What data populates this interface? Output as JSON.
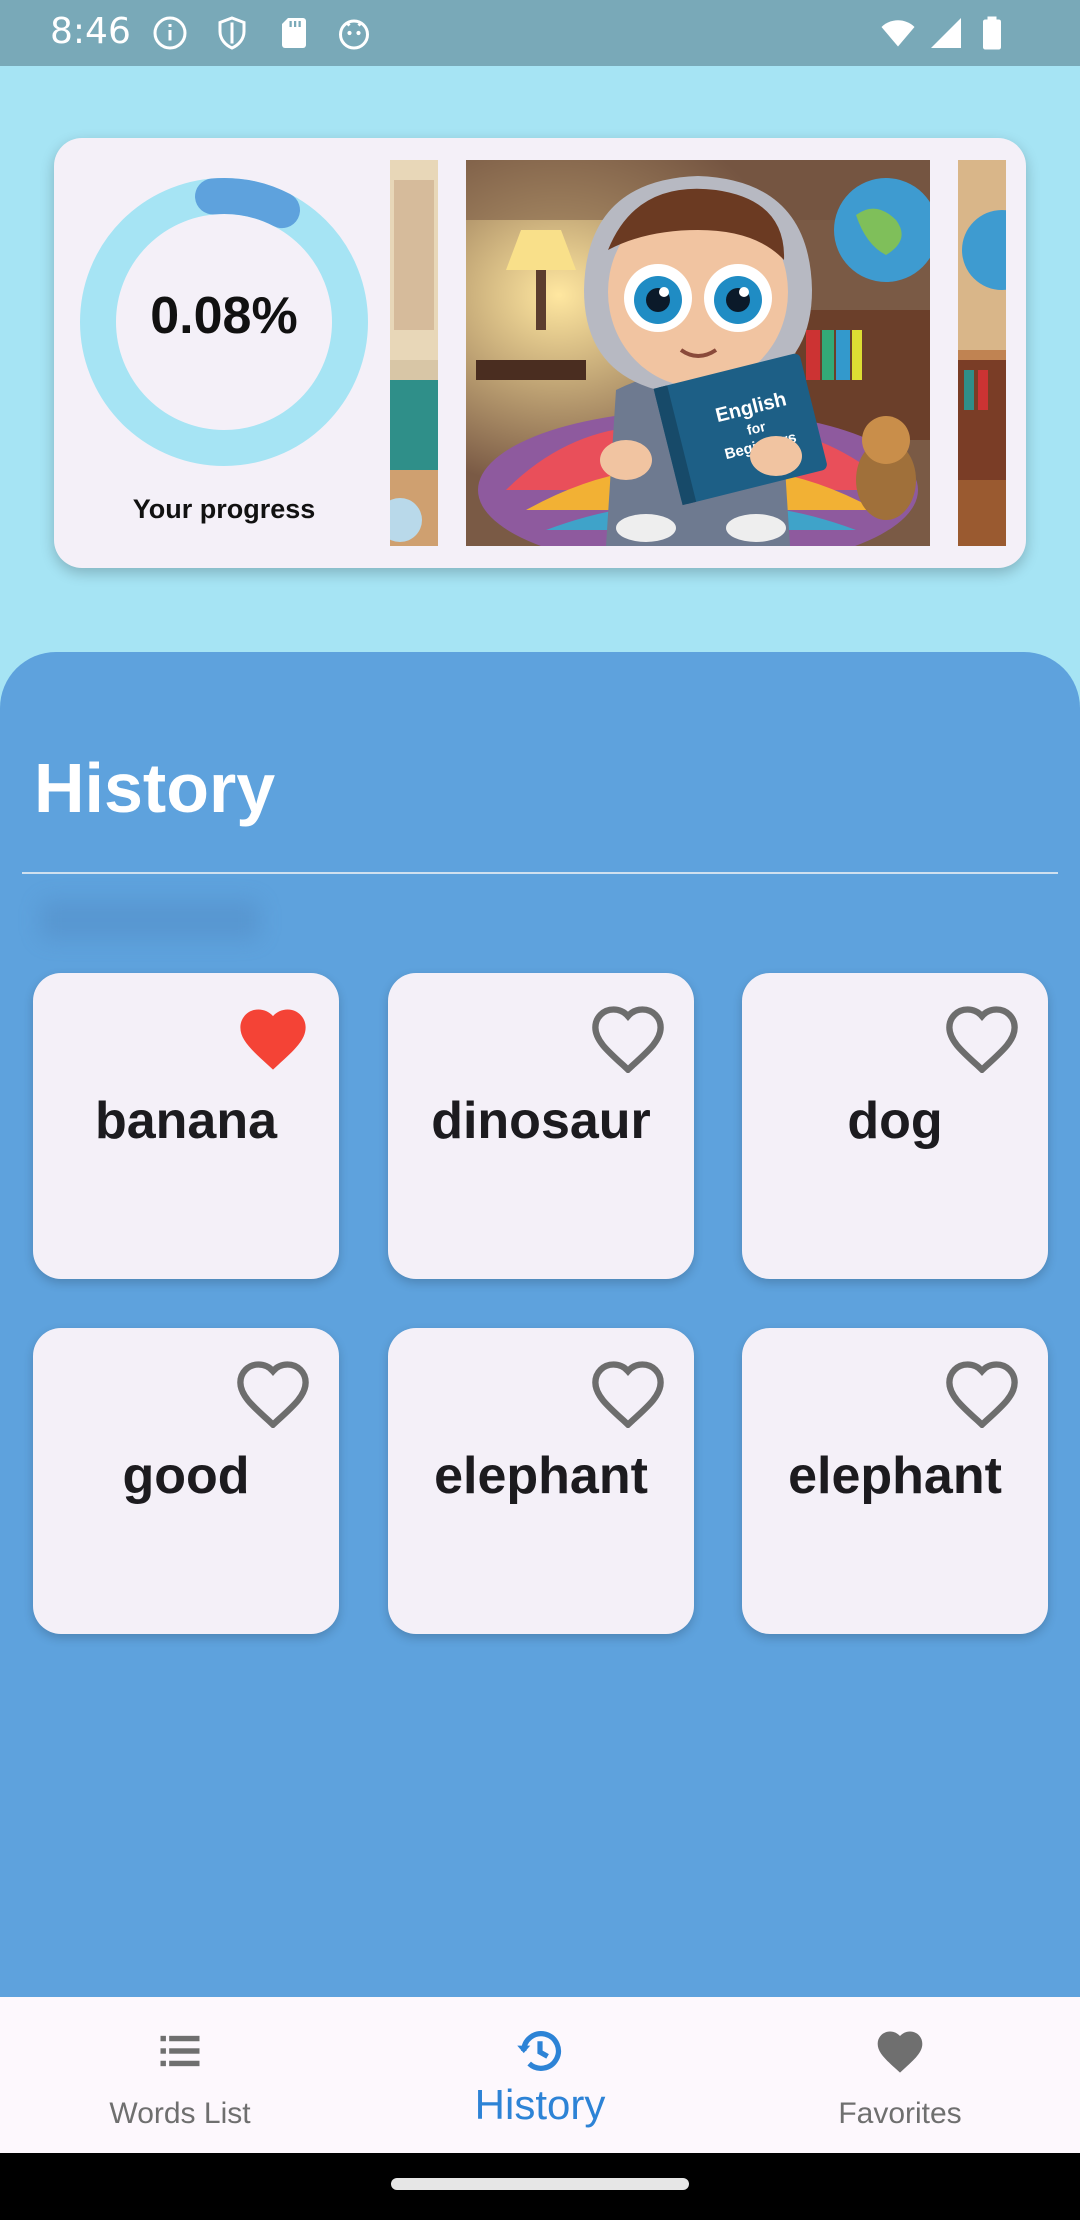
{
  "status_bar": {
    "time": "8:46",
    "left_icons": [
      "info-icon",
      "shield-icon",
      "sd-card-icon",
      "android-icon"
    ],
    "right_icons": [
      "wifi-icon",
      "signal-icon",
      "battery-icon"
    ]
  },
  "progress_card": {
    "value": "0.08%",
    "fraction": 0.0008,
    "label": "Your progress",
    "colors": {
      "track": "#a6e4f4",
      "arc": "#5ea2dd"
    }
  },
  "carousel": {
    "images": [
      "room-left-thumbnail",
      "boy-reading-english-book-illustration",
      "room-right-thumbnail"
    ],
    "book_title": "English for Beginners"
  },
  "history": {
    "title": "History",
    "words": [
      {
        "word": "banana",
        "favorite": true
      },
      {
        "word": "dinosaur",
        "favorite": false
      },
      {
        "word": "dog",
        "favorite": false
      },
      {
        "word": "good",
        "favorite": false
      },
      {
        "word": "elephant",
        "favorite": false
      },
      {
        "word": "elephant",
        "favorite": false
      }
    ]
  },
  "bottom_nav": {
    "items": [
      {
        "label": "Words List",
        "icon": "list-icon",
        "active": false
      },
      {
        "label": "History",
        "icon": "history-icon",
        "active": true
      },
      {
        "label": "Favorites",
        "icon": "heart-icon",
        "active": false
      }
    ]
  },
  "colors": {
    "panel": "#5ea2dd",
    "background": "#a6e4f4",
    "card": "#f4f0f8",
    "favorite": "#f44336",
    "accent": "#2d83d6"
  }
}
